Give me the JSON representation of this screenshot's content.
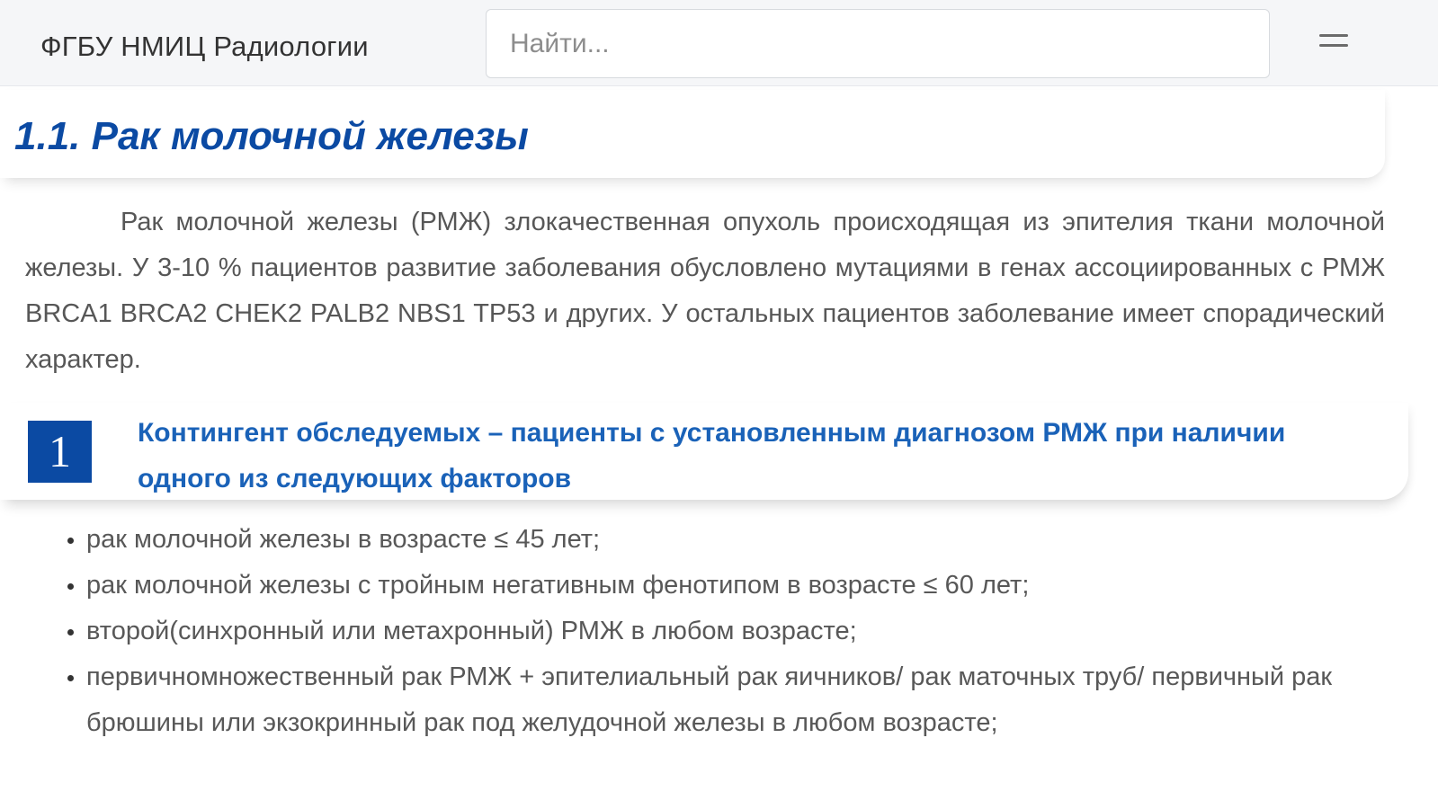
{
  "header": {
    "brand": "ФГБУ НМИЦ Радиологии",
    "search_placeholder": "Найти...",
    "menu_icon": "hamburger-menu-icon"
  },
  "page": {
    "title": "1.1. Рак молочной железы",
    "intro": "Рак молочной железы (РМЖ) злокачественная опухоль происходящая из эпителия ткани молочной железы. У 3-10 % пациентов развитие заболевания обусловлено мутациями в генах ассоциированных с РМЖ BRCA1 BRCA2 CHEK2 PALB2 NBS1 TP53 и других. У остальных пациентов заболевание имеет спорадический характер.",
    "section": {
      "number": "1",
      "title": "Контингент обследуемых – пациенты с установленным диагнозом РМЖ при наличии одного из следующих факторов"
    },
    "factors": [
      "рак молочной железы в возрасте ≤ 45 лет;",
      "рак молочной железы с тройным негативным фенотипом в возрасте ≤ 60 лет;",
      "второй(синхронный или метахронный) РМЖ в любом возрасте;",
      "первичномножественный рак РМЖ + эпителиальный рак яичников/ рак маточных труб/ первичный рак брюшины или экзокринный рак под желудочной железы в любом возрасте;"
    ]
  },
  "colors": {
    "accent": "#0b4aa3",
    "link": "#1a62b8",
    "header_bg": "#f5f6f8",
    "text": "#575757"
  }
}
